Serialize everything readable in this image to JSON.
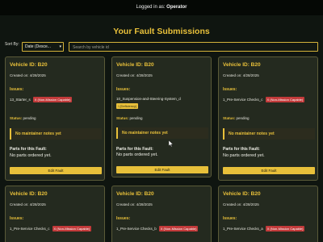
{
  "header": {
    "logged_in_prefix": "Logged in as: ",
    "user": "Operator"
  },
  "page_title": "Your Fault Submissions",
  "controls": {
    "sort_label": "Sort By:",
    "sort_value": "Date (Desce...",
    "search_placeholder": "Search by vehicle id"
  },
  "cards": [
    {
      "vehicle_id": "Vehicle ID: B20",
      "created": "Created on: 4/28/2025",
      "issues_label": "Issues:",
      "issue_name": "13_Starter_s",
      "badge": "X (Non-Mission Capable)",
      "status_label": "Status:",
      "status_value": "pending",
      "notes": "No maintainer notes yet",
      "parts_label": "Parts for this Fault:",
      "parts_value": "No parts ordered yet.",
      "edit_label": "Edit Fault"
    },
    {
      "vehicle_id": "Vehicle ID: B20",
      "created": "Created on: 4/28/2025",
      "issues_label": "Issues:",
      "issue_name": "10_Suspension-and-Steering-System_d",
      "badge": "/ (Deficiency)",
      "status_label": "Status:",
      "status_value": "pending",
      "notes": "No maintainer notes yet",
      "parts_label": "Parts for this Fault:",
      "parts_value": "No parts ordered yet.",
      "edit_label": "Edit Fault"
    },
    {
      "vehicle_id": "Vehicle ID: B20",
      "created": "Created on: 4/28/2025",
      "issues_label": "Issues:",
      "issue_name": "1_Pre-Service Checks_c",
      "badge": "X (Non-Mission Capable)",
      "status_label": "Status:",
      "status_value": "pending",
      "notes": "No maintainer notes yet",
      "parts_label": "Parts for this Fault:",
      "parts_value": "No parts ordered yet.",
      "edit_label": "Edit Fault"
    },
    {
      "vehicle_id": "Vehicle ID: B20",
      "created": "Created on: 4/28/2025",
      "issues_label": "Issues:",
      "issue_name": "1_Pre-Service Checks_c",
      "badge": "X (Non-Mission Capable)"
    },
    {
      "vehicle_id": "Vehicle ID: B20",
      "created": "Created on: 4/28/2025",
      "issues_label": "Issues:",
      "issue_name": "1_Pre-Service Checks_b",
      "badge": "X (Non-Mission Capable)"
    },
    {
      "vehicle_id": "Vehicle ID: B20",
      "created": "Created on: 4/28/2025",
      "issues_label": "Issues:",
      "issue_name": "1_Pre-Service Checks_a",
      "badge": "X (Non-Mission Capable)"
    }
  ],
  "colors": {
    "accent": "#e8c03a",
    "danger": "#c23a3a",
    "card_bg": "#242a1f",
    "page_bg": "#0f1510"
  }
}
